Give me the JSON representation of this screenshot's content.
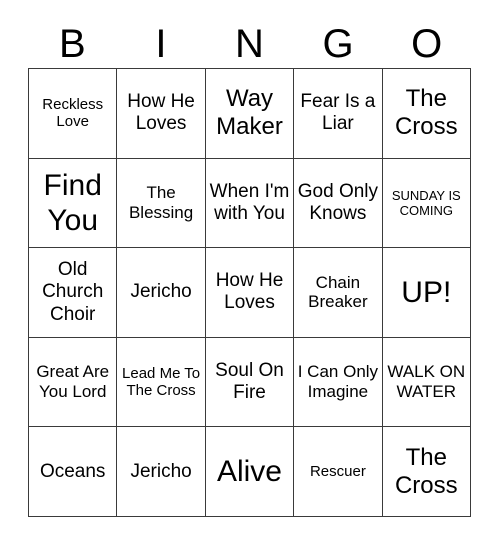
{
  "card": {
    "title": "BINGO Card",
    "header_letters": [
      "B",
      "I",
      "N",
      "G",
      "O"
    ],
    "grid_size": 5,
    "colors": {
      "border": "#3a3a3a",
      "cell_background": "#ffffff",
      "text": "#000000",
      "page_background": "#ffffff"
    },
    "cells": [
      {
        "text": "Reckless Love",
        "size": "sm"
      },
      {
        "text": "How He Loves",
        "size": "lg"
      },
      {
        "text": "Way Maker",
        "size": "xl"
      },
      {
        "text": "Fear Is a Liar",
        "size": "lg"
      },
      {
        "text": "The Cross",
        "size": "xl"
      },
      {
        "text": "Find You",
        "size": "xxl"
      },
      {
        "text": "The Blessing",
        "size": "md"
      },
      {
        "text": "When I'm with You",
        "size": "lg"
      },
      {
        "text": "God Only Knows",
        "size": "lg"
      },
      {
        "text": "SUNDAY IS COMING",
        "size": "xs"
      },
      {
        "text": "Old Church Choir",
        "size": "lg"
      },
      {
        "text": "Jericho",
        "size": "lg"
      },
      {
        "text": "How He Loves",
        "size": "lg"
      },
      {
        "text": "Chain Breaker",
        "size": "md"
      },
      {
        "text": "UP!",
        "size": "xxl"
      },
      {
        "text": "Great Are You Lord",
        "size": "md"
      },
      {
        "text": "Lead Me To The Cross",
        "size": "sm"
      },
      {
        "text": "Soul On Fire",
        "size": "lg"
      },
      {
        "text": "I Can Only Imagine",
        "size": "md"
      },
      {
        "text": "WALK ON WATER",
        "size": "md"
      },
      {
        "text": "Oceans",
        "size": "lg"
      },
      {
        "text": "Jericho",
        "size": "lg"
      },
      {
        "text": "Alive",
        "size": "xxl"
      },
      {
        "text": "Rescuer",
        "size": "sm"
      },
      {
        "text": "The Cross",
        "size": "xl"
      }
    ]
  }
}
